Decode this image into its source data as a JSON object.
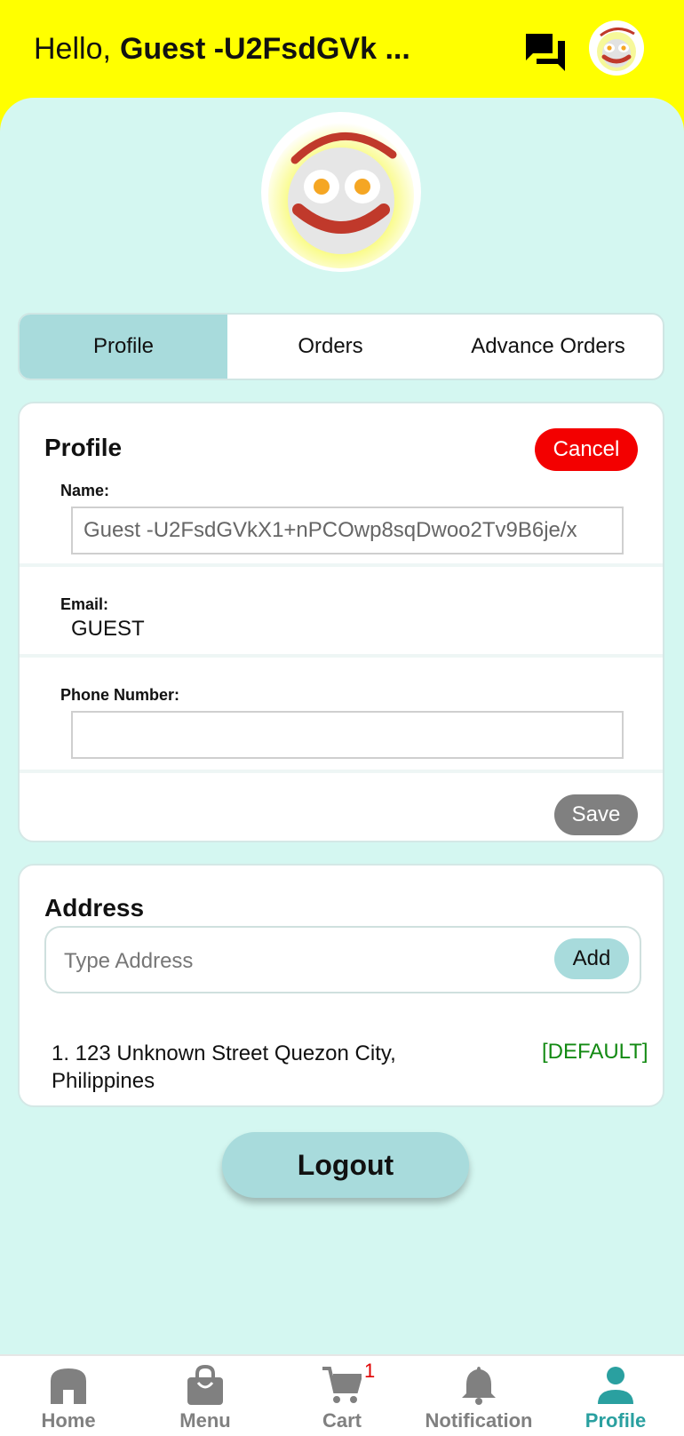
{
  "header": {
    "greeting": "Hello,",
    "user_name": "Guest -U2FsdGVk ..."
  },
  "tabs": [
    {
      "label": "Profile",
      "active": true
    },
    {
      "label": "Orders",
      "active": false
    },
    {
      "label": "Advance Orders",
      "active": false
    }
  ],
  "profile": {
    "title": "Profile",
    "cancel_label": "Cancel",
    "name_label": "Name:",
    "name_value": "Guest -U2FsdGVkX1+nPCOwp8sqDwoo2Tv9B6je/x",
    "email_label": "Email:",
    "email_value": "GUEST",
    "phone_label": "Phone Number:",
    "phone_value": "",
    "save_label": "Save"
  },
  "address": {
    "title": "Address",
    "placeholder": "Type Address",
    "add_label": "Add",
    "items": [
      {
        "text": "1. 123 Unknown Street Quezon City, Philippines",
        "tag": "[DEFAULT]"
      }
    ]
  },
  "logout_label": "Logout",
  "nav": [
    {
      "label": "Home",
      "icon": "home-icon"
    },
    {
      "label": "Menu",
      "icon": "shopping-bag-icon"
    },
    {
      "label": "Cart",
      "icon": "cart-icon",
      "badge": "1"
    },
    {
      "label": "Notification",
      "icon": "bell-icon"
    },
    {
      "label": "Profile",
      "icon": "person-icon",
      "active": true
    }
  ],
  "colors": {
    "header_bg": "#ffff00",
    "content_bg": "#d4f7f1",
    "accent": "#a8dbdc",
    "cancel": "#f30000",
    "save": "#808080",
    "default_tag": "#138a13",
    "nav_active": "#2aa0a0",
    "nav_inactive": "#808080",
    "badge": "#e00000"
  }
}
